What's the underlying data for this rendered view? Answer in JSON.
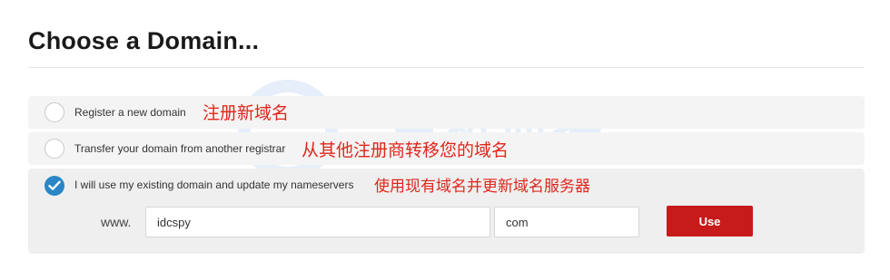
{
  "page": {
    "title": "Choose a Domain..."
  },
  "options": [
    {
      "label": "Register a new domain",
      "annotation": "注册新域名",
      "selected": false
    },
    {
      "label": "Transfer your domain from another registrar",
      "annotation": "从其他注册商转移您的域名",
      "selected": false
    },
    {
      "label": "I will use my existing domain and update my nameservers",
      "annotation": "使用现有域名并更新域名服务器",
      "selected": true
    }
  ],
  "domain_form": {
    "prefix": "www.",
    "sld_value": "idcspy",
    "tld_value": "com",
    "submit_label": "Use"
  },
  "watermark": {
    "text": "主机侦探",
    "sub": "出海"
  },
  "colors": {
    "accent_blue": "#2a86c6",
    "button_red": "#c71a1a",
    "annotation_red": "#e0261c"
  }
}
